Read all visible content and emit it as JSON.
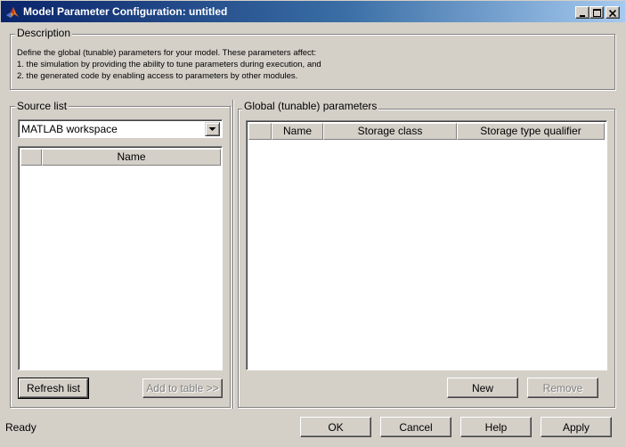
{
  "window": {
    "title": "Model Parameter Configuration: untitled",
    "controls": {
      "minimize": "_",
      "maximize": "□",
      "close": "×"
    }
  },
  "description": {
    "legend": "Description",
    "lines": [
      "Define the global (tunable) parameters for your model. These parameters affect:",
      "1. the simulation by providing the ability to tune parameters during execution, and",
      "2. the generated code by enabling access to parameters by other modules."
    ]
  },
  "source_list": {
    "legend": "Source list",
    "source_select": "MATLAB workspace",
    "table": {
      "columns": [
        "",
        "Name"
      ],
      "rows": []
    },
    "refresh_label": "Refresh list",
    "add_label": "Add to table >>"
  },
  "global_params": {
    "legend": "Global (tunable) parameters",
    "table": {
      "columns": [
        "",
        "Name",
        "Storage class",
        "Storage type qualifier"
      ],
      "rows": []
    },
    "new_label": "New",
    "remove_label": "Remove"
  },
  "footer": {
    "status": "Ready",
    "ok_label": "OK",
    "cancel_label": "Cancel",
    "help_label": "Help",
    "apply_label": "Apply"
  },
  "colors": {
    "face": "#d4d0c8",
    "title_start": "#0a246a",
    "title_end": "#a6caf0",
    "disabled_text": "#808080"
  },
  "icons": {
    "app": "matlab-logo-icon",
    "dropdown": "chevron-down-icon"
  }
}
